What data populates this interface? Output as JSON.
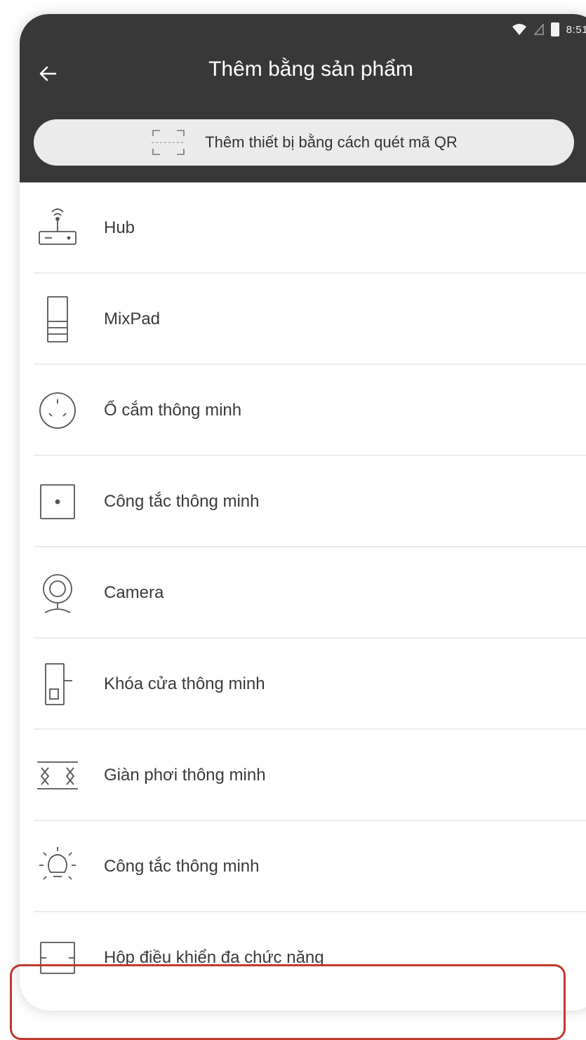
{
  "status_bar": {
    "time": "8:51"
  },
  "header": {
    "title": "Thêm bằng sản phẩm",
    "back_icon": "arrow-left-icon"
  },
  "qr_button": {
    "label": "Thêm thiết bị bằng cách quét mã QR",
    "icon": "qr-scan-icon"
  },
  "items": [
    {
      "label": "Hub",
      "icon": "hub-icon"
    },
    {
      "label": "MixPad",
      "icon": "mixpad-icon"
    },
    {
      "label": "Ổ cắm thông minh",
      "icon": "smart-socket-icon"
    },
    {
      "label": "Công tắc thông minh",
      "icon": "smart-switch-icon"
    },
    {
      "label": "Camera",
      "icon": "camera-icon"
    },
    {
      "label": "Khóa cửa thông minh",
      "icon": "door-lock-icon"
    },
    {
      "label": "Giàn phơi thông minh",
      "icon": "clothes-rack-icon"
    },
    {
      "label": "Công tắc thông minh",
      "icon": "light-switch-icon"
    },
    {
      "label": "Hộp điều khiển đa chức năng",
      "icon": "control-box-icon",
      "highlighted": true
    }
  ],
  "colors": {
    "header_bg": "#383838",
    "highlight": "#c0392b"
  }
}
